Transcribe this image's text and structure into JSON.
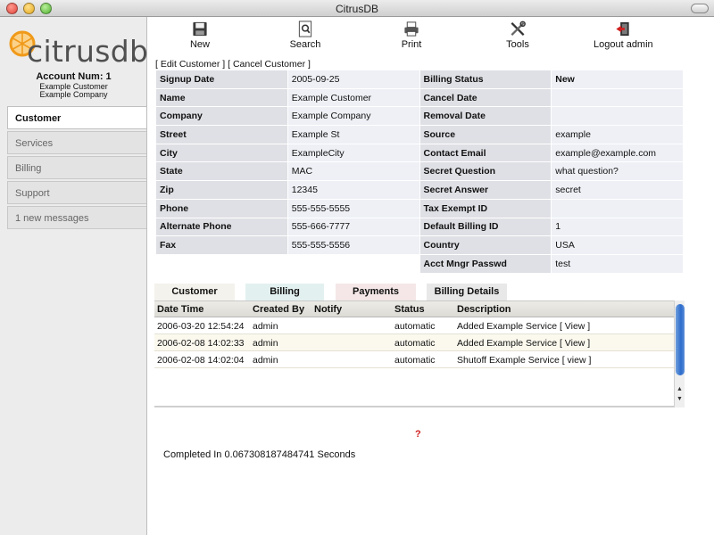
{
  "window": {
    "title": "CitrusDB"
  },
  "brand": {
    "logo_text": "citrusdb",
    "accent": "#f09a1a"
  },
  "account": {
    "number_label": "Account Num:  1",
    "name": "Example Customer",
    "company": "Example Company"
  },
  "sidebar": {
    "items": [
      {
        "label": "Customer"
      },
      {
        "label": "Services"
      },
      {
        "label": "Billing"
      },
      {
        "label": "Support"
      },
      {
        "label": "1 new messages"
      }
    ]
  },
  "toolbar": {
    "new": "New",
    "search": "Search",
    "print": "Print",
    "tools": "Tools",
    "logout": "Logout admin"
  },
  "links": {
    "edit": "[ Edit Customer ]",
    "cancel": "[ Cancel Customer ]"
  },
  "info": {
    "rows": [
      {
        "l1": "Signup Date",
        "v1": "2005-09-25",
        "l2": "Billing Status",
        "v2": "New"
      },
      {
        "l1": "Name",
        "v1": "Example Customer",
        "l2": "Cancel Date",
        "v2": ""
      },
      {
        "l1": "Company",
        "v1": "Example Company",
        "l2": "Removal Date",
        "v2": ""
      },
      {
        "l1": "Street",
        "v1": "Example St",
        "l2": "Source",
        "v2": "example"
      },
      {
        "l1": "City",
        "v1": "ExampleCity",
        "l2": "Contact Email",
        "v2": "example@example.com"
      },
      {
        "l1": "State",
        "v1": "MAC",
        "l2": "Secret Question",
        "v2": "what question?"
      },
      {
        "l1": "Zip",
        "v1": "12345",
        "l2": "Secret Answer",
        "v2": "secret"
      },
      {
        "l1": "Phone",
        "v1": "555-555-5555",
        "l2": "Tax Exempt ID",
        "v2": ""
      },
      {
        "l1": "Alternate Phone",
        "v1": "555-666-7777",
        "l2": "Default Billing ID",
        "v2": "1"
      },
      {
        "l1": "Fax",
        "v1": "555-555-5556",
        "l2": "Country",
        "v2": "USA"
      },
      {
        "l1": "",
        "v1": "",
        "l2": "Acct Mngr Passwd",
        "v2": "test"
      }
    ]
  },
  "tabs": [
    {
      "label": "Customer"
    },
    {
      "label": "Billing"
    },
    {
      "label": "Payments"
    },
    {
      "label": "Billing Details"
    }
  ],
  "log": {
    "headers": [
      "Date Time",
      "Created By",
      "Notify",
      "Status",
      "Description"
    ],
    "rows": [
      {
        "datetime": "2006-03-20 12:54:24",
        "created_by": "admin",
        "notify": "",
        "status": "automatic",
        "description": "Added Example Service [ View ]"
      },
      {
        "datetime": "2006-02-08 14:02:33",
        "created_by": "admin",
        "notify": "",
        "status": "automatic",
        "description": "Added Example Service [ View ]"
      },
      {
        "datetime": "2006-02-08 14:02:04",
        "created_by": "admin",
        "notify": "",
        "status": "automatic",
        "description": "Shutoff Example Service [ view ]"
      }
    ]
  },
  "help": "?",
  "footer": {
    "completed": "Completed In 0.067308187484741 Seconds"
  }
}
